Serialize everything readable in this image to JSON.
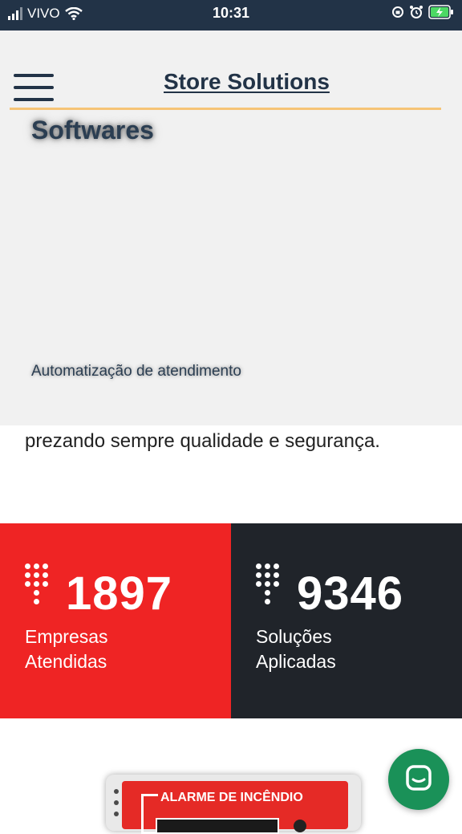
{
  "status_bar": {
    "carrier": "VIVO",
    "time": "10:31",
    "icons": [
      "signal-icon",
      "wifi-icon",
      "rotation-lock-icon",
      "alarm-icon",
      "battery-charging-icon"
    ]
  },
  "header": {
    "menu_icon": "hamburger-icon",
    "brand": "Store Solutions"
  },
  "menu": {
    "item_softwares": "Softwares",
    "item_automation": "Automatização de atendimento"
  },
  "body": {
    "text": "prezando sempre qualidade e segurança."
  },
  "stats": [
    {
      "number": "1897",
      "label_line1": "Empresas",
      "label_line2": "Atendidas",
      "bg": "#ef2424"
    },
    {
      "number": "9346",
      "label_line1": "Soluções",
      "label_line2": "Aplicadas",
      "bg": "#20242a"
    }
  ],
  "product": {
    "title": "ALARME DE INCÊNDIO"
  },
  "chat_button": {
    "icon": "chat-icon",
    "color": "#1a9158"
  },
  "colors": {
    "brand": "#223347",
    "accent_line": "#f6c476"
  }
}
